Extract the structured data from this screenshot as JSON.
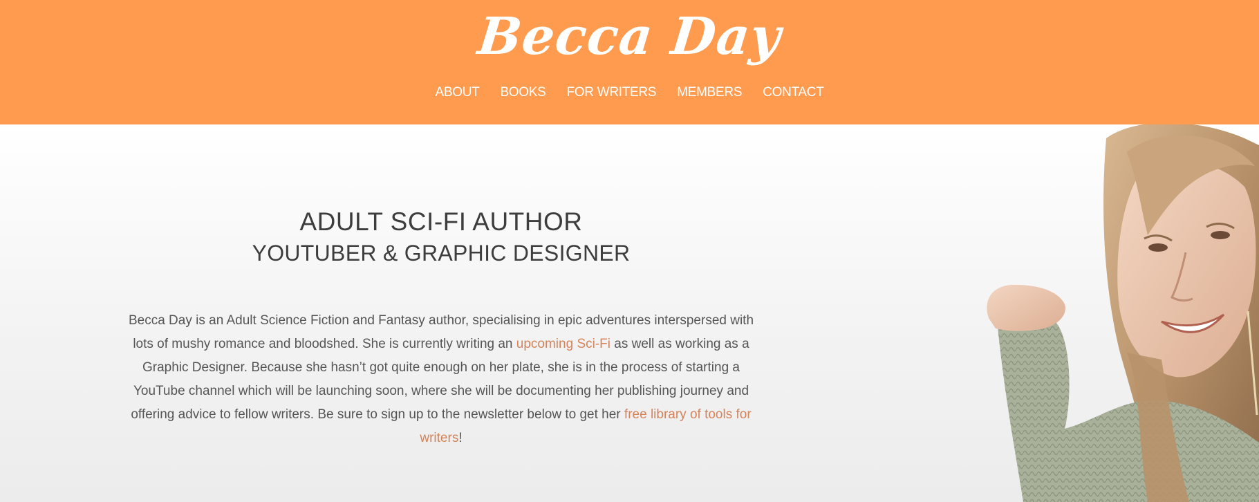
{
  "header": {
    "logo_text": "Becca Day",
    "bg_color": "#FF9B4E",
    "nav": [
      {
        "label": "ABOUT"
      },
      {
        "label": "BOOKS"
      },
      {
        "label": "FOR WRITERS"
      },
      {
        "label": "MEMBERS"
      },
      {
        "label": "CONTACT"
      }
    ]
  },
  "hero": {
    "headline_1": "ADULT SCI-FI AUTHOR",
    "headline_2": "YOUTUBER & GRAPHIC DESIGNER",
    "bio": {
      "part1": "Becca Day is an Adult Science Fiction and Fantasy author, specialising in epic adventures interspersed with lots of mushy romance and bloodshed. She is currently writing an ",
      "link1": "upcoming Sci-Fi",
      "part2": " as well as working as a Graphic Designer. Because she hasn’t got quite enough on her plate, she is in the process of starting a YouTube channel which will be launching soon, where she will be documenting her publishing journey and offering advice to fellow writers. Be sure to sign up to the newsletter below to get her ",
      "link2": "free library of tools for writers",
      "part3": "!"
    },
    "link_color": "#D4835A",
    "portrait_icon": "author-portrait-photo"
  }
}
